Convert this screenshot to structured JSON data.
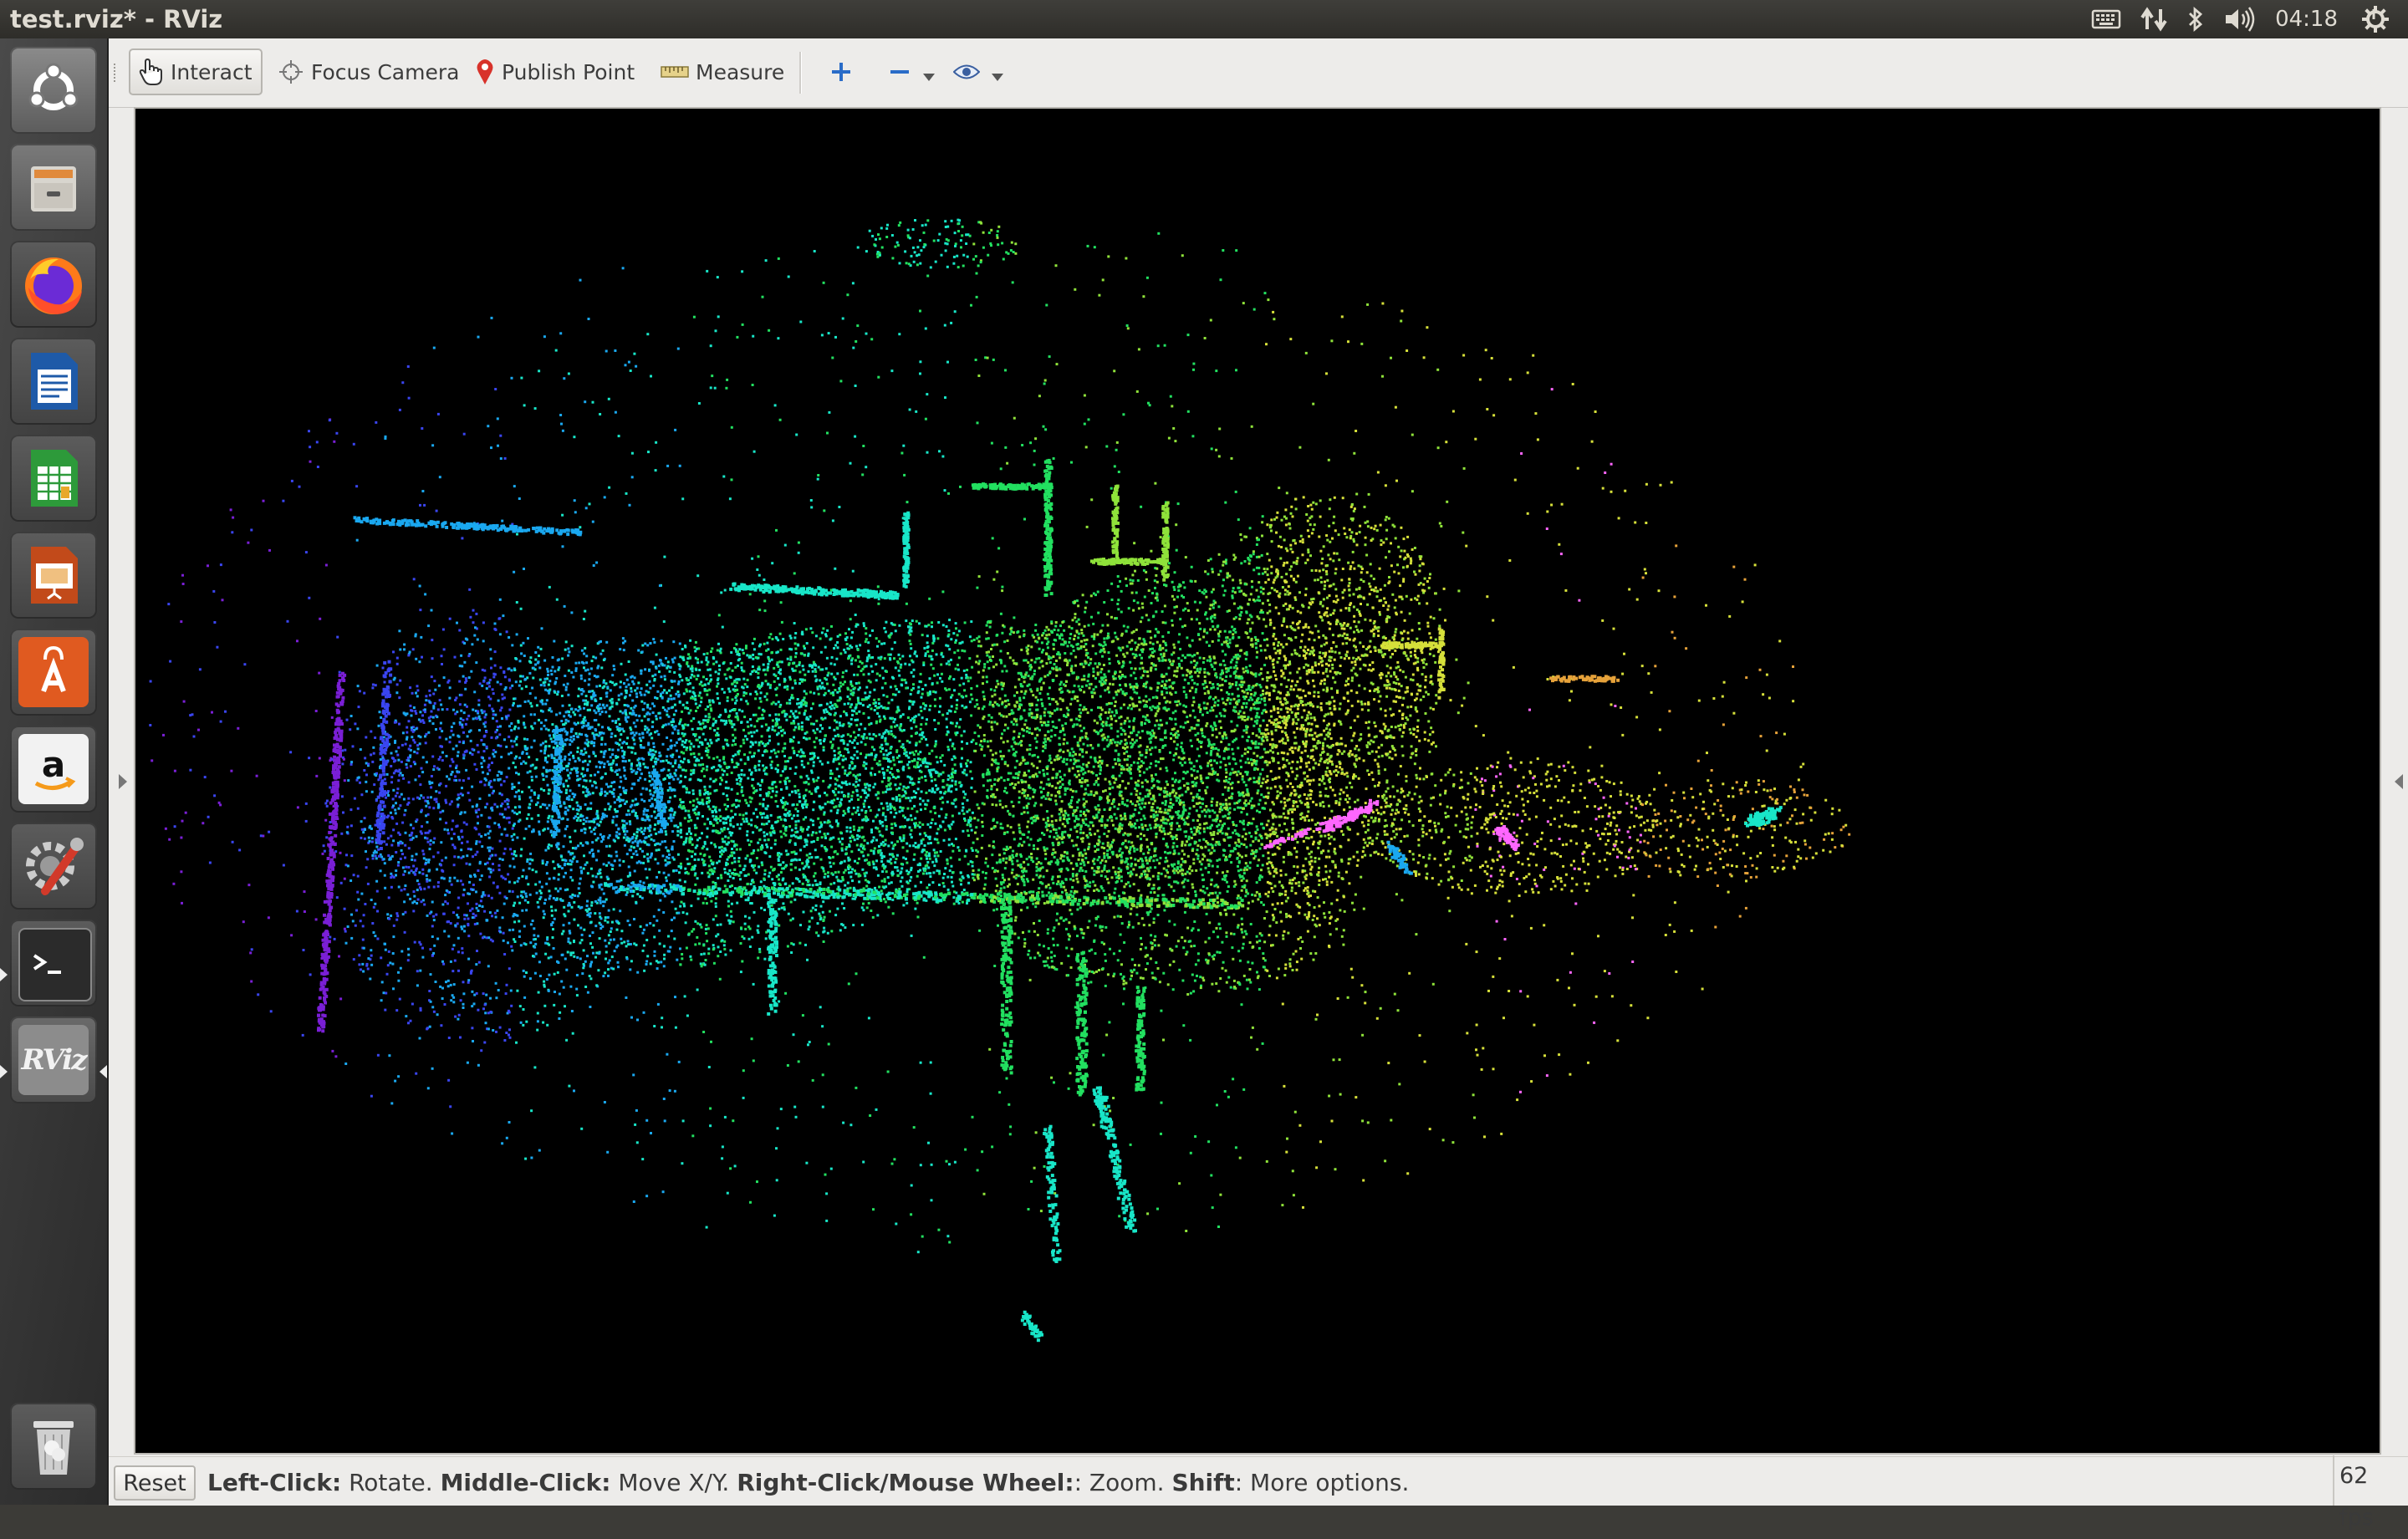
{
  "window": {
    "title": "test.rviz* - RViz"
  },
  "tray": {
    "clock": "04:18"
  },
  "launcher": {
    "items": [
      {
        "name": "ubuntu-dash",
        "icon": "ubuntu-logo-icon"
      },
      {
        "name": "files",
        "icon": "file-cabinet-icon"
      },
      {
        "name": "firefox",
        "icon": "firefox-icon"
      },
      {
        "name": "writer",
        "icon": "libreoffice-writer-icon"
      },
      {
        "name": "calc",
        "icon": "libreoffice-calc-icon"
      },
      {
        "name": "impress",
        "icon": "libreoffice-impress-icon"
      },
      {
        "name": "software-center",
        "icon": "shopping-bag-icon"
      },
      {
        "name": "amazon",
        "icon": "amazon-icon"
      },
      {
        "name": "system-settings",
        "icon": "settings-wrench-icon"
      },
      {
        "name": "terminal",
        "icon": "terminal-icon"
      },
      {
        "name": "rviz",
        "icon": "rviz-icon",
        "label": "RViz"
      },
      {
        "name": "trash",
        "icon": "trash-icon"
      }
    ]
  },
  "toolbar": {
    "interact": "Interact",
    "focus_camera": "Focus Camera",
    "publish_point": "Publish Point",
    "measure": "Measure"
  },
  "status": {
    "reset": "Reset",
    "help": [
      {
        "key": "Left-Click:",
        "text": " Rotate. "
      },
      {
        "key": "Middle-Click:",
        "text": " Move X/Y. "
      },
      {
        "key": "Right-Click/Mouse Wheel:",
        "text": ": Zoom. "
      },
      {
        "key": "Shift",
        "text": ": More options."
      }
    ],
    "fps": "62 fps"
  },
  "colors": {
    "pointcloud_palette": [
      "#7a1fd6",
      "#3a45f0",
      "#1aa8f0",
      "#18e6c8",
      "#22e060",
      "#8fe23a",
      "#d6e03a",
      "#e6a23a",
      "#ff66ff"
    ]
  }
}
